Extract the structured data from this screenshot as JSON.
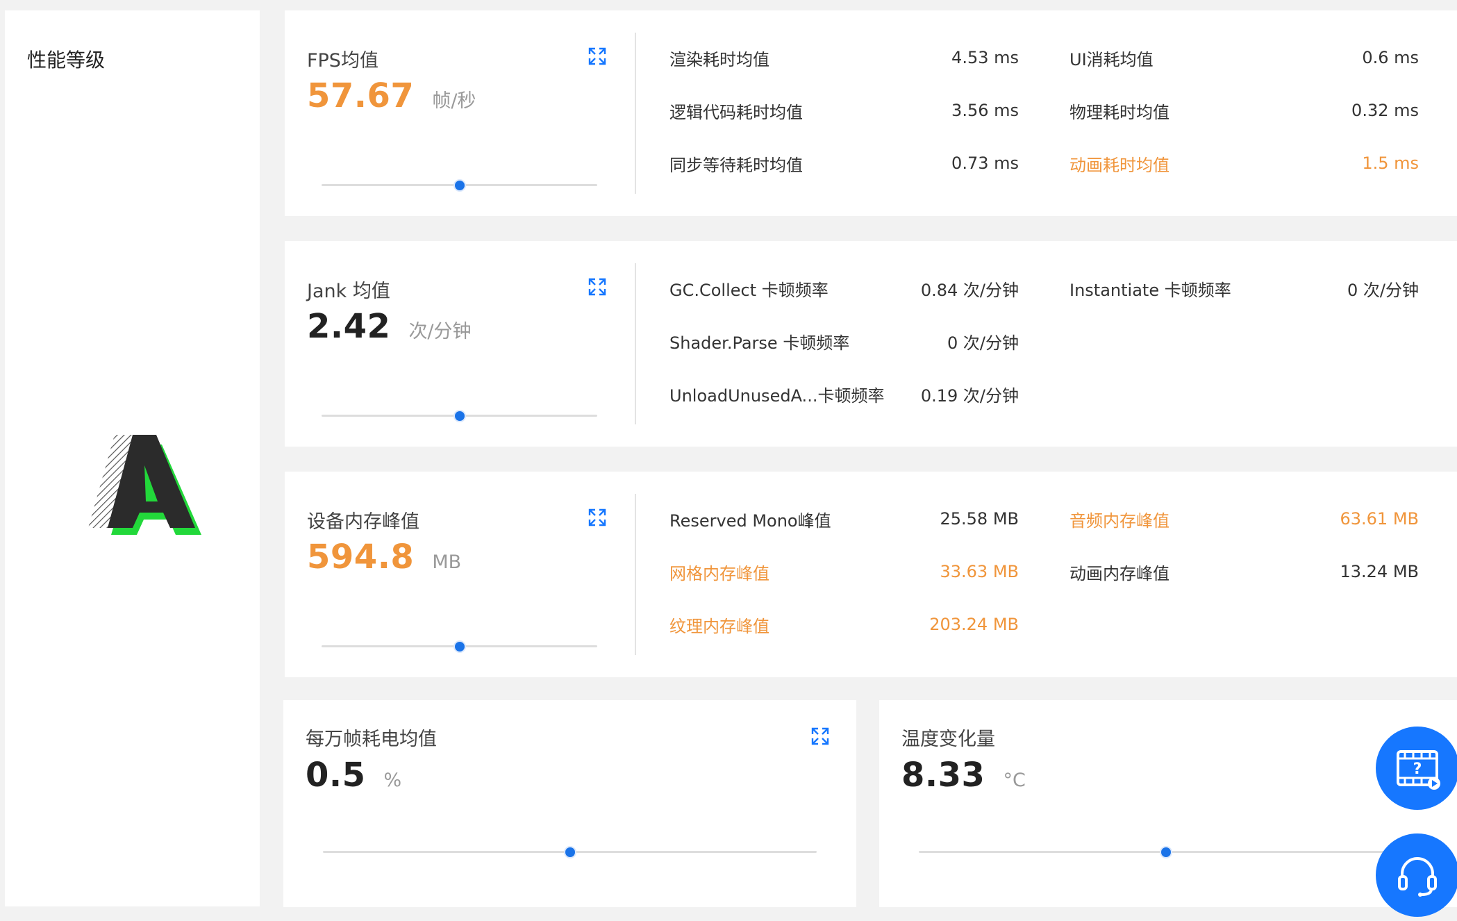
{
  "grade_panel": {
    "title": "性能等级"
  },
  "fps_card": {
    "label": "FPS均值",
    "value": "57.67",
    "unit": "帧/秒",
    "slider_fraction": 0.5,
    "stats": [
      {
        "label": "渲染耗时均值",
        "value": "4.53 ms",
        "highlight": false
      },
      {
        "label": "UI消耗均值",
        "value": "0.6 ms",
        "highlight": false
      },
      {
        "label": "逻辑代码耗时均值",
        "value": "3.56 ms",
        "highlight": false
      },
      {
        "label": "物理耗时均值",
        "value": "0.32 ms",
        "highlight": false
      },
      {
        "label": "同步等待耗时均值",
        "value": "0.73 ms",
        "highlight": false
      },
      {
        "label": "动画耗时均值",
        "value": "1.5 ms",
        "highlight": true
      }
    ]
  },
  "jank_card": {
    "label": "Jank 均值",
    "value": "2.42",
    "unit": "次/分钟",
    "slider_fraction": 0.5,
    "stats": [
      {
        "label": "GC.Collect 卡顿频率",
        "value": "0.84 次/分钟",
        "highlight": false
      },
      {
        "label": "Instantiate 卡顿频率",
        "value": "0 次/分钟",
        "highlight": false
      },
      {
        "label": "Shader.Parse 卡顿频率",
        "value": "0 次/分钟",
        "highlight": false
      },
      {
        "label": "UnloadUnusedA...卡顿频率",
        "value": "0.19 次/分钟",
        "highlight": false
      }
    ]
  },
  "memory_card": {
    "label": "设备内存峰值",
    "value": "594.8",
    "unit": "MB",
    "slider_fraction": 0.5,
    "stats": [
      {
        "label": "Reserved Mono峰值",
        "value": "25.58 MB",
        "highlight": false
      },
      {
        "label": "音频内存峰值",
        "value": "63.61 MB",
        "highlight": true
      },
      {
        "label": "网格内存峰值",
        "value": "33.63 MB",
        "highlight": true
      },
      {
        "label": "动画内存峰值",
        "value": "13.24 MB",
        "highlight": false
      },
      {
        "label": "纹理内存峰值",
        "value": "203.24 MB",
        "highlight": true
      }
    ]
  },
  "power_card": {
    "label": "每万帧耗电均值",
    "value": "0.5",
    "unit": "%",
    "slider_fraction": 0.5
  },
  "temp_card": {
    "label": "温度变化量",
    "value": "8.33",
    "unit": "°C",
    "slider_fraction": 0.5
  },
  "colors": {
    "accent_orange": "#f0953b",
    "accent_blue": "#1677ff",
    "logo_green": "#22d83a"
  },
  "icons": {
    "expand": "expand-icon",
    "video_help": "video-help-icon",
    "support": "headset-icon"
  }
}
